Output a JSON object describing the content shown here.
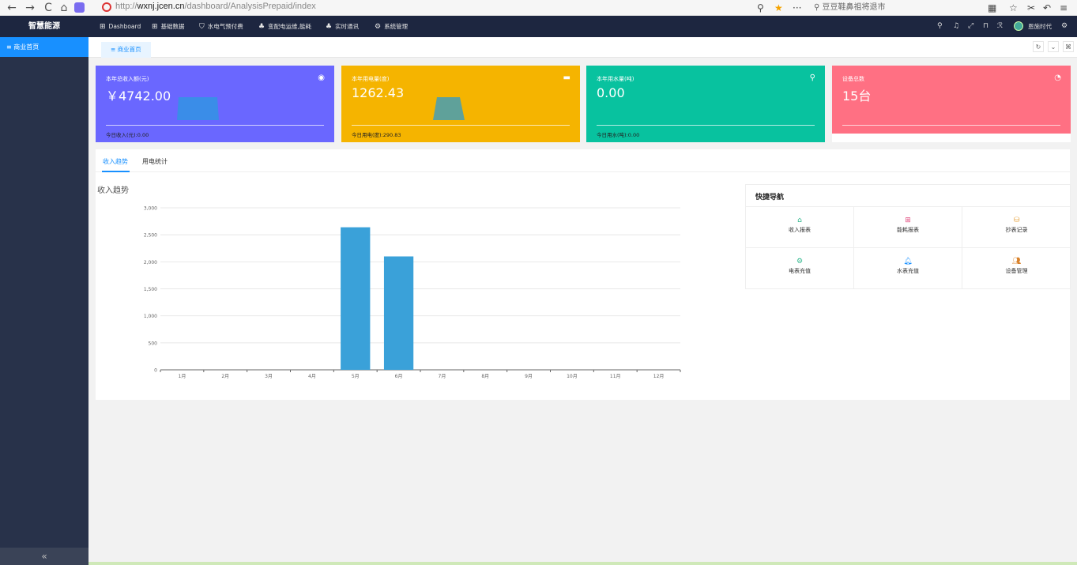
{
  "browser": {
    "nav": [
      "←",
      "→",
      "C",
      "⌂"
    ],
    "url_prefix": "http://",
    "url_host": "wxnj.jcen.cn",
    "url_path": "/dashboard/AnalysisPrepaid/index",
    "search_placeholder": "豆豆鞋鼻祖将退市"
  },
  "app": {
    "logo": "智慧能源",
    "sidebar_item": "商业首页",
    "collapse": "«",
    "user": "恩施时代"
  },
  "topnav": [
    {
      "icon": "⊞",
      "label": "Dashboard",
      "name": "dashboard"
    },
    {
      "icon": "⊞",
      "label": "基础数据",
      "name": "basic-data"
    },
    {
      "icon": "⛉",
      "label": "水电气预付费",
      "name": "prepaid"
    },
    {
      "icon": "♣",
      "label": "变配电运维,能耗",
      "name": "power-ops"
    },
    {
      "icon": "♣",
      "label": "实时通讯",
      "name": "realtime"
    },
    {
      "icon": "⚙",
      "label": "系统管理",
      "name": "system"
    }
  ],
  "tabbar": {
    "home_tab": "商业首页"
  },
  "cards": [
    {
      "label": "本年总收入额(元)",
      "value": "￥4742.00",
      "foot": "今日收入(元):0.00",
      "color": "#6a67ff"
    },
    {
      "label": "本年用电量(度)",
      "value": "1262.43",
      "foot": "今日用电(度):290.83",
      "color": "#f5b400"
    },
    {
      "label": "本年用水量(吨)",
      "value": "0.00",
      "foot": "今日用水(吨):0.00",
      "color": "#08c29f"
    },
    {
      "label": "设备总数",
      "value": "15台",
      "foot": "",
      "color": "#ff7083"
    }
  ],
  "tabs": {
    "income": "收入趋势",
    "power": "用电统计"
  },
  "chart_title": "收入趋势",
  "quick_nav": {
    "title": "快捷导航",
    "items": [
      {
        "label": "收入报表",
        "icon": "home-icon",
        "color": "#2bb58a"
      },
      {
        "label": "能耗报表",
        "icon": "grid-icon",
        "color": "#e0457a"
      },
      {
        "label": "抄表记录",
        "icon": "database-icon",
        "color": "#e6a23c"
      },
      {
        "label": "电表充值",
        "icon": "gear-icon",
        "color": "#2bb58a"
      },
      {
        "label": "水表充值",
        "icon": "bell-icon",
        "color": "#1890ff"
      },
      {
        "label": "设备管理",
        "icon": "users-icon",
        "color": "#d9822b"
      }
    ]
  },
  "chart_data": {
    "type": "bar",
    "categories": [
      "1月",
      "2月",
      "3月",
      "4月",
      "5月",
      "6月",
      "7月",
      "8月",
      "9月",
      "10月",
      "11月",
      "12月"
    ],
    "values": [
      0,
      0,
      0,
      0,
      2640,
      2100,
      0,
      0,
      0,
      0,
      0,
      0
    ],
    "ylim": [
      0,
      3000
    ],
    "yticks": [
      0,
      500,
      1000,
      1500,
      2000,
      2500,
      3000
    ],
    "ytick_labels": [
      "0",
      "500",
      "1,000",
      "1,500",
      "2,000",
      "2,500",
      "3,000"
    ],
    "grid": true,
    "bar_color": "#3aa1d9"
  }
}
